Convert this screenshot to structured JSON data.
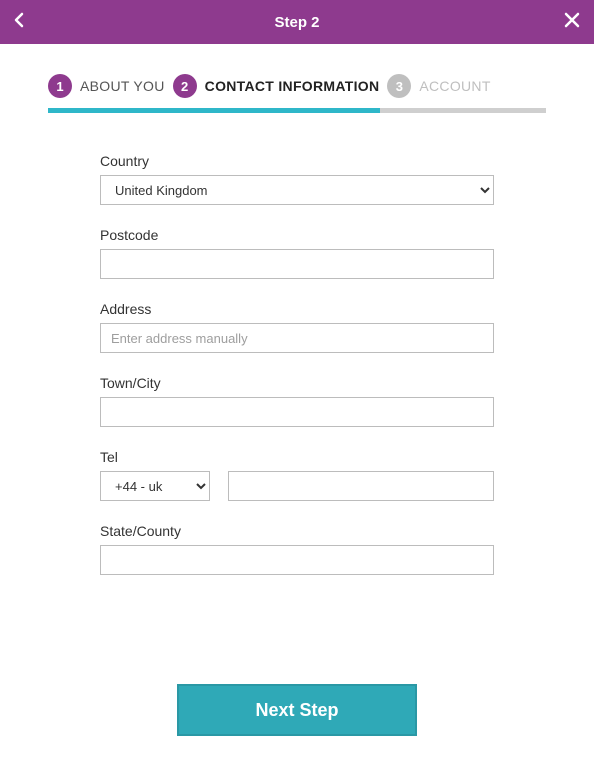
{
  "header": {
    "title": "Step 2"
  },
  "stepper": {
    "steps": [
      {
        "num": "1",
        "label": "ABOUT YOU",
        "state": "done"
      },
      {
        "num": "2",
        "label": "CONTACT INFORMATION",
        "state": "active"
      },
      {
        "num": "3",
        "label": "ACCOUNT",
        "state": "pending"
      }
    ]
  },
  "form": {
    "country": {
      "label": "Country",
      "value": "United Kingdom"
    },
    "postcode": {
      "label": "Postcode",
      "value": ""
    },
    "address": {
      "label": "Address",
      "placeholder": "Enter address manually",
      "value": ""
    },
    "towncity": {
      "label": "Town/City",
      "value": ""
    },
    "tel": {
      "label": "Tel",
      "code": "+44 - uk",
      "number": ""
    },
    "statecounty": {
      "label": "State/County",
      "value": ""
    }
  },
  "footer": {
    "next_label": "Next Step"
  }
}
